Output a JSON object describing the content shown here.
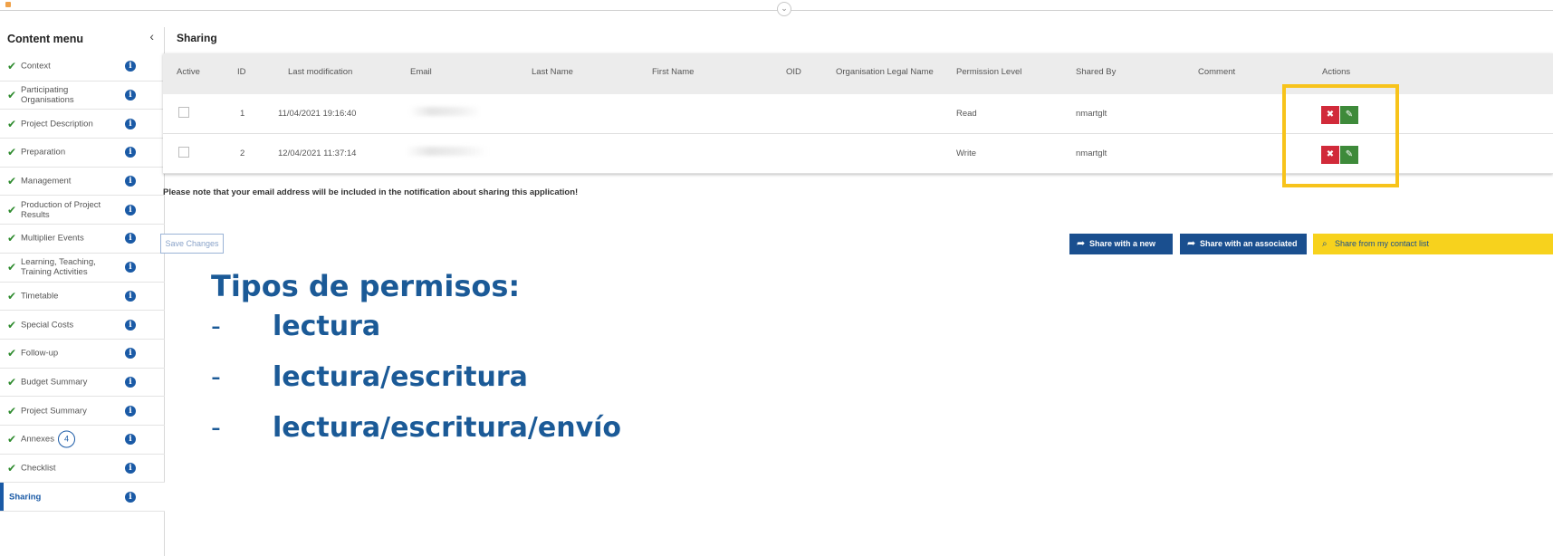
{
  "sidebar": {
    "title": "Content menu",
    "collapse_icon": "‹",
    "items": [
      {
        "label": "Context",
        "checked": true
      },
      {
        "label": "Participating Organisations",
        "checked": true
      },
      {
        "label": "Project Description",
        "checked": true
      },
      {
        "label": "Preparation",
        "checked": true
      },
      {
        "label": "Management",
        "checked": true
      },
      {
        "label": "Production of Project Results",
        "checked": true
      },
      {
        "label": "Multiplier Events",
        "checked": true
      },
      {
        "label": "Learning, Teaching, Training Activities",
        "checked": true
      },
      {
        "label": "Timetable",
        "checked": true
      },
      {
        "label": "Special Costs",
        "checked": true
      },
      {
        "label": "Follow-up",
        "checked": true
      },
      {
        "label": "Budget Summary",
        "checked": true
      },
      {
        "label": "Project Summary",
        "checked": true
      },
      {
        "label": "Annexes",
        "badge": "4",
        "checked": true
      },
      {
        "label": "Checklist",
        "checked": true
      },
      {
        "label": "Sharing",
        "active": true
      }
    ]
  },
  "main": {
    "title": "Sharing",
    "table": {
      "headers": [
        "Active",
        "ID",
        "Last modification",
        "Email",
        "Last Name",
        "First Name",
        "OID",
        "Organisation Legal Name",
        "Permission Level",
        "Shared By",
        "Comment",
        "Actions"
      ],
      "rows": [
        {
          "id": "1",
          "last_modification": "11/04/2021 19:16:40",
          "permission": "Read",
          "shared_by": "nmartglt"
        },
        {
          "id": "2",
          "last_modification": "12/04/2021 11:37:14",
          "permission": "Write",
          "shared_by": "nmartglt"
        }
      ]
    },
    "notice": "Please note that your email address will be included in the notification about sharing this application!",
    "save_label": "Save Changes",
    "share_new_label": "Share with a new person",
    "share_associated_label": "Share with an associated person",
    "share_contact_label": "Share from my contact list"
  },
  "overlay": {
    "title": "Tipos de permisos:",
    "bullets": [
      "lectura",
      "lectura/escritura",
      "lectura/escritura/envío"
    ]
  },
  "colors": {
    "accent_blue": "#1a4f8f",
    "check_green": "#2e8b2e",
    "delete_red": "#d12a3a",
    "highlight_yellow": "#f7c31b",
    "overlay_text": "#1b5a97"
  }
}
